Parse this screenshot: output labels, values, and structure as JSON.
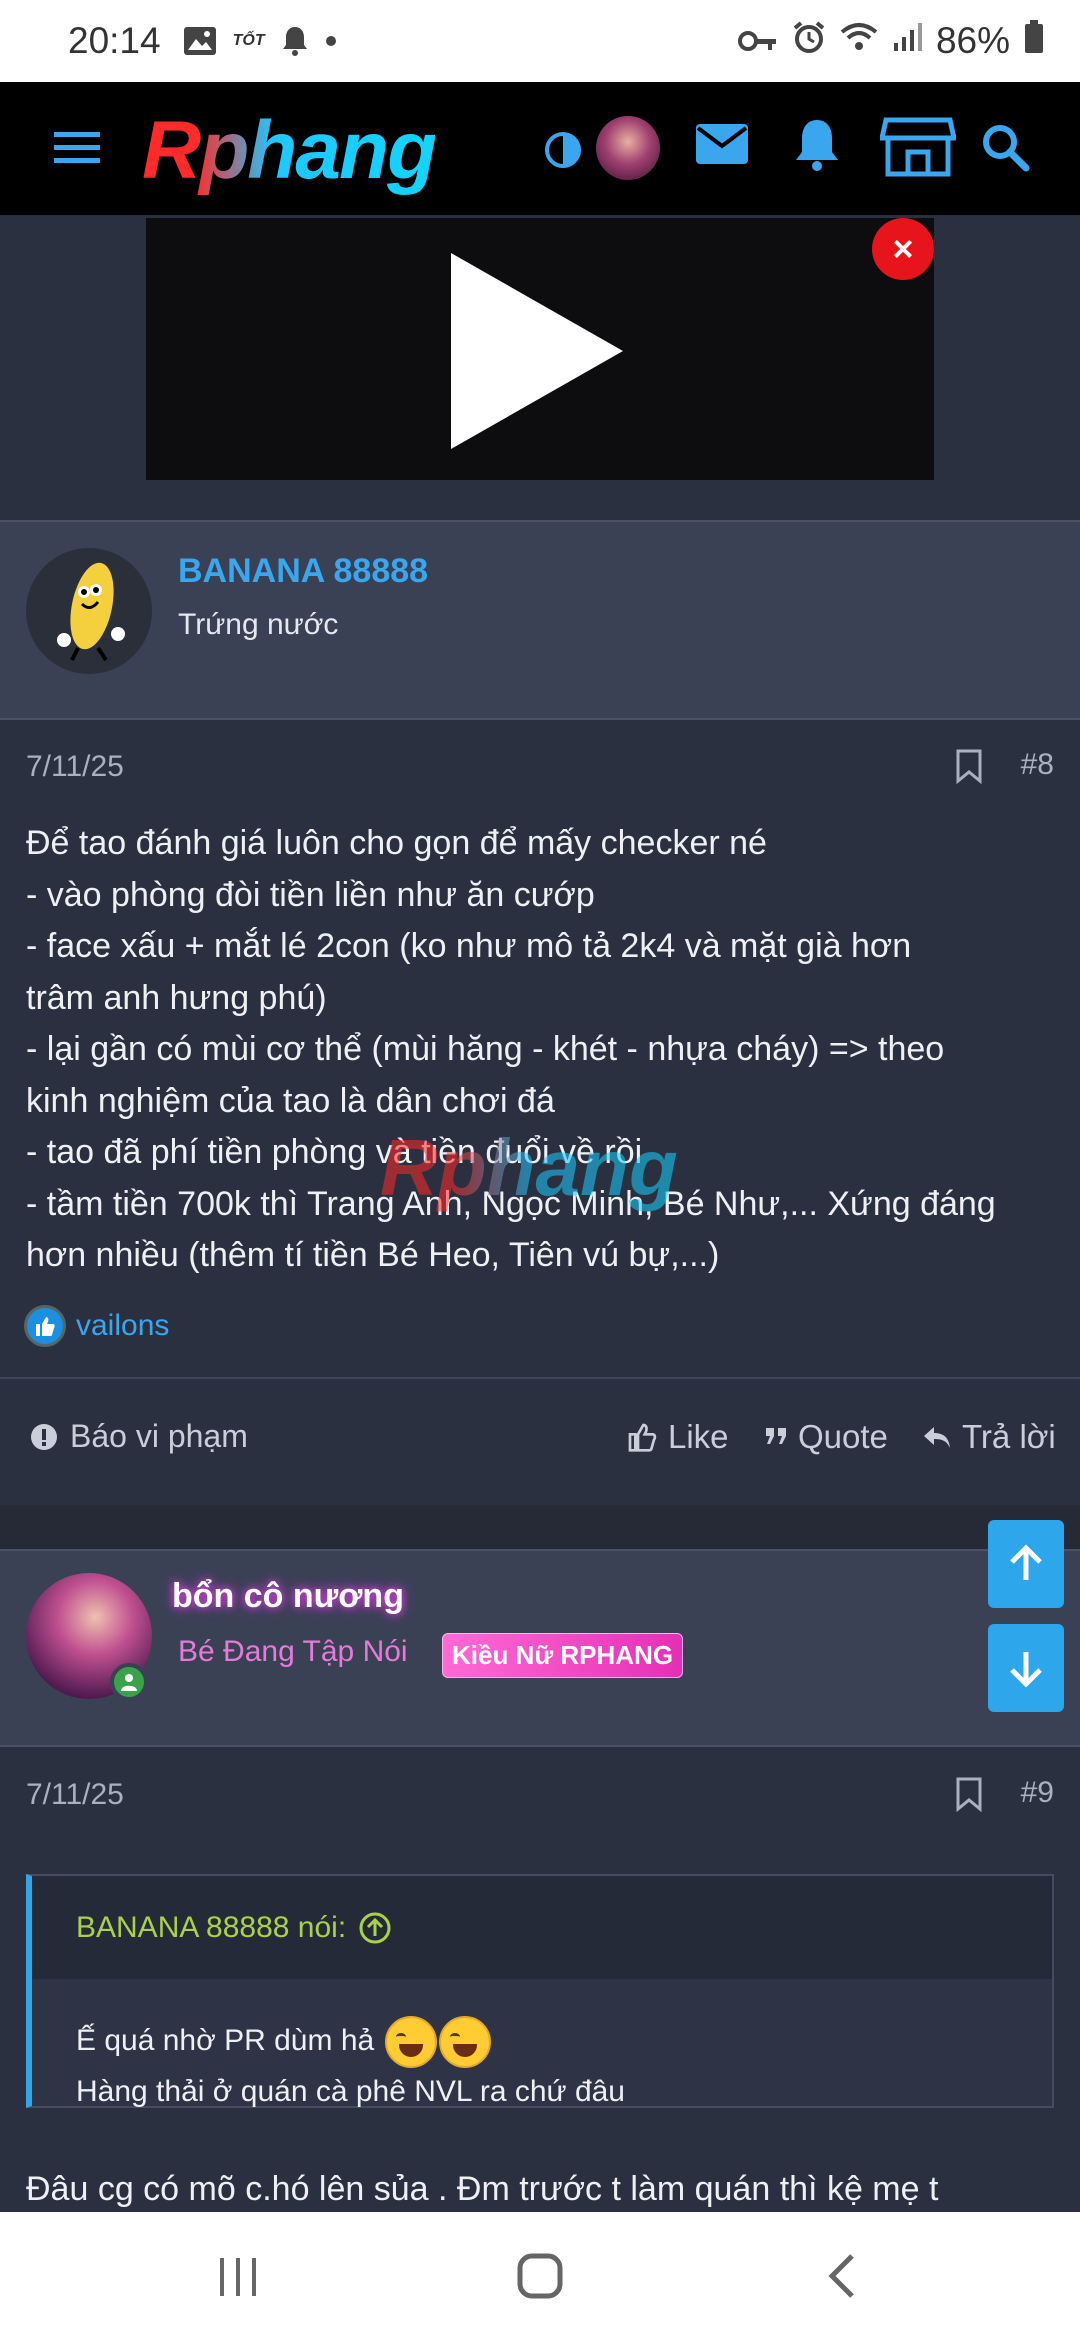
{
  "status_bar": {
    "time": "20:14",
    "tot_label": "TỐT",
    "battery": "86%"
  },
  "header": {
    "logo_text": "Rphang",
    "icons": [
      "menu-icon",
      "theme-toggle-icon",
      "avatar",
      "mail-icon",
      "bell-icon",
      "store-icon",
      "search-icon"
    ]
  },
  "video": {
    "close_label": "×"
  },
  "post1": {
    "username": "BANANA 88888",
    "user_title": "Trứng nước",
    "date": "7/11/25",
    "number": "#8",
    "lines": [
      "Để tao đánh giá luôn cho gọn để mấy checker né",
      "- vào phòng đòi tiền liền như ăn cướp",
      "- face xấu + mắt lé 2con (ko như mô tả 2k4 và mặt già hơn",
      "trâm anh hưng phú)",
      "- lại gần có mùi cơ thể (mùi hăng - khét - nhựa cháy) => theo",
      "kinh nghiệm của tao là dân chơi đá",
      "- tao đã phí tiền phòng và tiền đuổi về rồi",
      "- tầm tiền 700k thì Trang Anh, Ngọc Minh, Bé Như,... Xứng đáng",
      "hơn nhiều (thêm tí tiền Bé Heo, Tiên vú bự,...)"
    ],
    "reaction_user": "vailons",
    "report_label": "Báo vi phạm",
    "like_label": "Like",
    "quote_label": "Quote",
    "reply_label": "Trả lời"
  },
  "watermark": "Rphang",
  "post2": {
    "username": "bổn cô nương",
    "user_title": "Bé Đang Tập Nói",
    "badge": "Kiều Nữ RPHANG",
    "date": "7/11/25",
    "number": "#9",
    "quote_author": "BANANA 88888 nói:",
    "quote_line1": "Ế quá nhờ PR dùm hả",
    "quote_line2": "Hàng thải ở quán cà phê NVL ra chứ đâu",
    "body_partial": "Đâu cg có mõ c.hó lên sủa . Đm trước t làm quán thì kệ mẹ t"
  },
  "colors": {
    "accent": "#2ea6ec",
    "background": "#2b3040",
    "user_bar": "#3a4155",
    "quote_author": "#a8d24a",
    "badge_pink": "#e52fb6"
  }
}
